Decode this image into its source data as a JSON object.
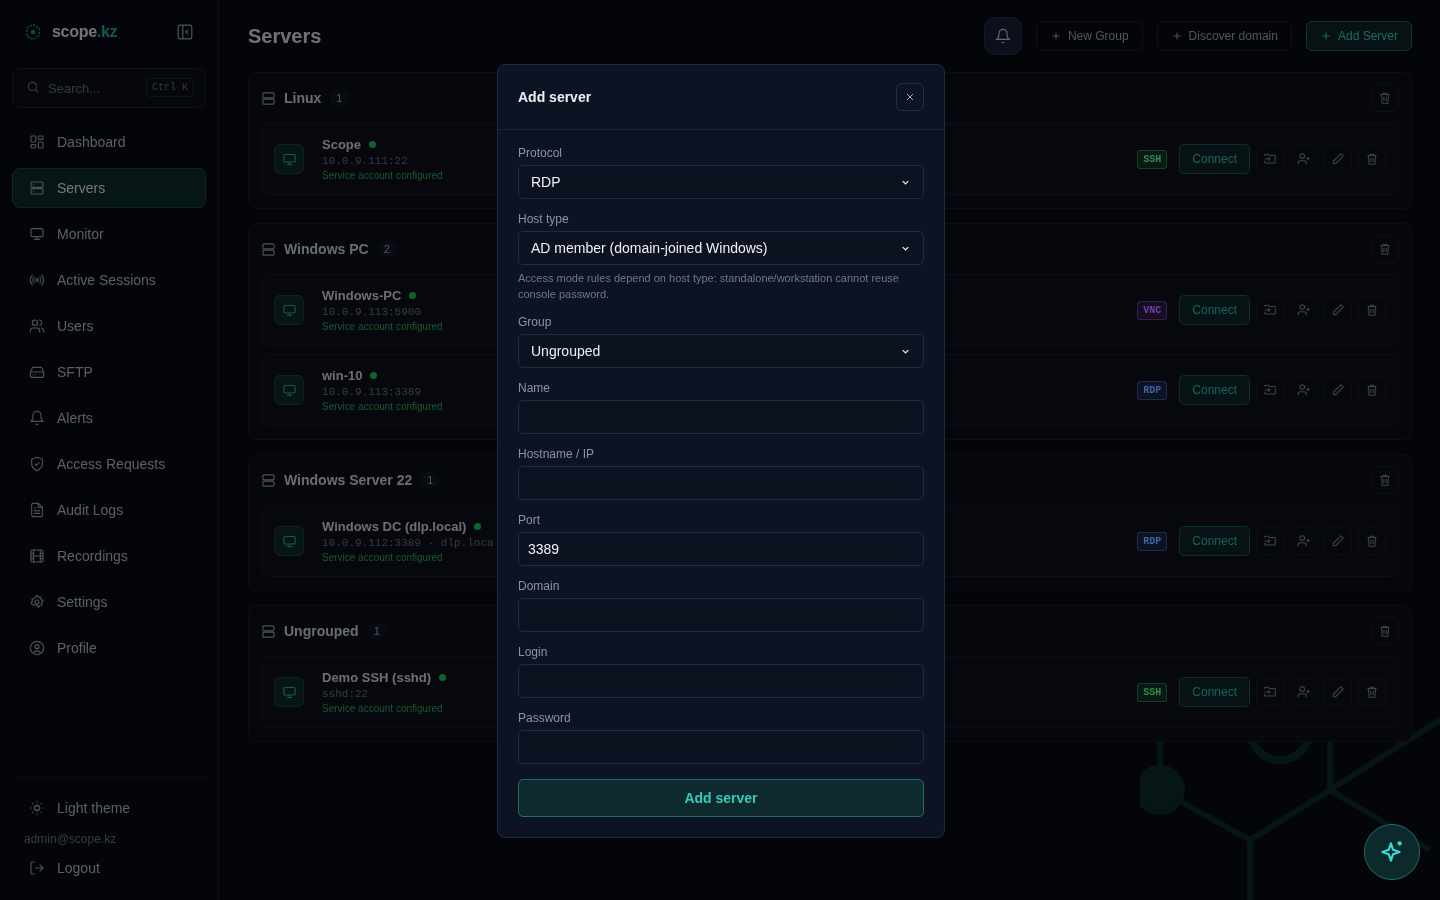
{
  "brand": {
    "name": "scope",
    "tld": ".kz"
  },
  "search": {
    "placeholder": "Search...",
    "shortcut": "Ctrl K"
  },
  "nav": [
    {
      "label": "Dashboard",
      "selected": false
    },
    {
      "label": "Servers",
      "selected": true
    },
    {
      "label": "Monitor",
      "selected": false
    },
    {
      "label": "Active Sessions",
      "selected": false
    },
    {
      "label": "Users",
      "selected": false
    },
    {
      "label": "SFTP",
      "selected": false
    },
    {
      "label": "Alerts",
      "selected": false
    },
    {
      "label": "Access Requests",
      "selected": false
    },
    {
      "label": "Audit Logs",
      "selected": false
    },
    {
      "label": "Recordings",
      "selected": false
    },
    {
      "label": "Settings",
      "selected": false
    },
    {
      "label": "Profile",
      "selected": false
    }
  ],
  "footer": {
    "theme_toggle": "Light theme",
    "email": "admin@scope.kz",
    "logout": "Logout"
  },
  "page_title": "Servers",
  "toolbar": [
    {
      "label": "New Group",
      "kind": "plain"
    },
    {
      "label": "Discover domain",
      "kind": "plain"
    },
    {
      "label": "Add Server",
      "kind": "primary"
    }
  ],
  "groups": [
    {
      "name": "Linux",
      "count": "1",
      "servers": [
        {
          "name": "Scope",
          "online": true,
          "address": "10.0.9.111:22",
          "status": "Service account configured",
          "protocol": "SSH",
          "color": "#2f8f4e",
          "connect": "Connect"
        }
      ]
    },
    {
      "name": "Windows PC",
      "count": "2",
      "servers": [
        {
          "name": "Windows-PC",
          "online": true,
          "address": "10.0.9.113:5900",
          "status": "Service account configured",
          "protocol": "VNC",
          "color": "#7a3fb0",
          "connect": "Connect"
        },
        {
          "name": "win-10",
          "online": true,
          "address": "10.0.9.113:3389",
          "status": "Service account configured",
          "protocol": "RDP",
          "color": "#3f63a6",
          "connect": "Connect"
        }
      ]
    },
    {
      "name": "Windows Server 22",
      "count": "1",
      "servers": [
        {
          "name": "Windows DC (dlp.local)",
          "online": true,
          "address": "10.0.9.112:3389 · dlp.loca",
          "status": "Service account configured",
          "protocol": "RDP",
          "color": "#3f63a6",
          "connect": "Connect"
        }
      ]
    },
    {
      "name": "Ungrouped",
      "count": "1",
      "servers": [
        {
          "name": "Demo SSH (sshd)",
          "online": true,
          "address": "sshd:22",
          "status": "Service account configured",
          "protocol": "SSH",
          "color": "#2f8f4e",
          "connect": "Connect"
        }
      ]
    }
  ],
  "modal": {
    "title": "Add server",
    "fields": [
      {
        "label": "Protocol",
        "kind": "select",
        "value": "RDP"
      },
      {
        "label": "Host type",
        "kind": "select",
        "value": "AD member (domain-joined Windows)",
        "hint": "Access mode rules depend on host type: standalone/workstation cannot reuse console password."
      },
      {
        "label": "Group",
        "kind": "select",
        "value": "Ungrouped"
      },
      {
        "label": "Name",
        "kind": "input"
      },
      {
        "label": "Hostname / IP",
        "kind": "input"
      },
      {
        "label": "Port",
        "kind": "input",
        "value": "3389"
      },
      {
        "label": "Domain",
        "kind": "input"
      },
      {
        "label": "Login",
        "kind": "input"
      },
      {
        "label": "Password",
        "kind": "input"
      }
    ],
    "submit": "Add server"
  }
}
